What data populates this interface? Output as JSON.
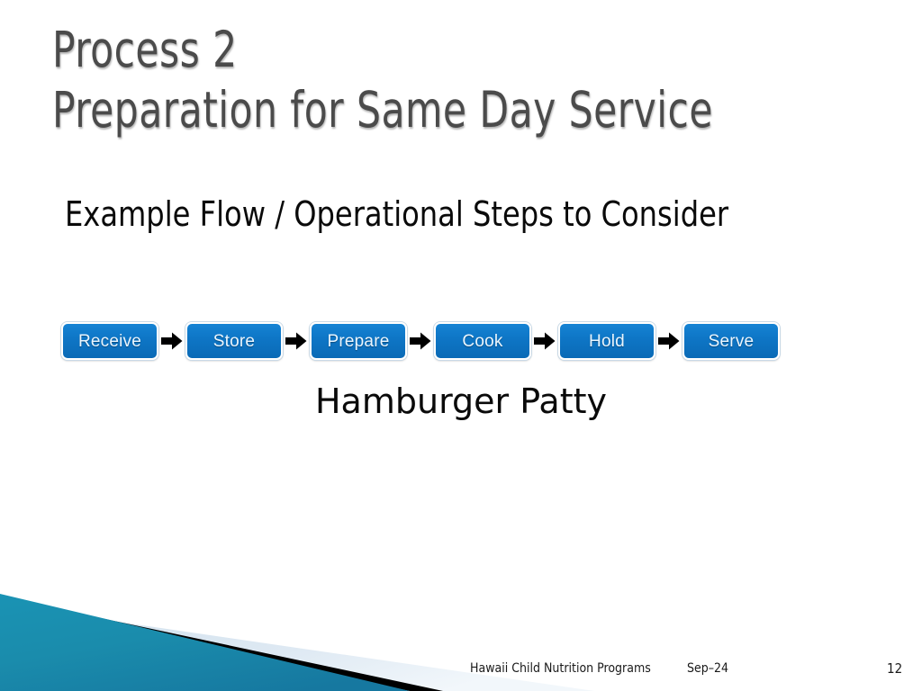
{
  "slide": {
    "title_lines": [
      "Process 2",
      "Preparation for Same Day Service"
    ],
    "subtitle": "Example Flow / Operational Steps to Consider",
    "item_caption": "Hamburger Patty",
    "colors": {
      "title_text": "#4b4b4b",
      "body_text": "#0a0a0a",
      "step_fill": "#0e76c6",
      "step_border": "#ffffff",
      "step_label": "#eaf6ff",
      "arrow": "#000000",
      "decor_teal": "#1b8fad",
      "decor_black": "#000000",
      "decor_pale": "#dce8f2",
      "background": "#ffffff"
    }
  },
  "flow": {
    "steps": [
      {
        "label": "Receive"
      },
      {
        "label": "Store"
      },
      {
        "label": "Prepare"
      },
      {
        "label": "Cook"
      },
      {
        "label": "Hold"
      },
      {
        "label": "Serve"
      }
    ],
    "arrow_icon": "right-arrow-icon"
  },
  "footer": {
    "organization": "Hawaii Child Nutrition Programs",
    "date": "Sep–24",
    "page_number": "12"
  }
}
